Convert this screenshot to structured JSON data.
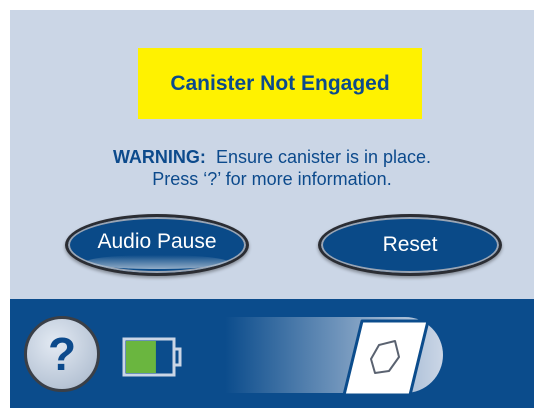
{
  "alert": {
    "title": "Canister Not Engaged"
  },
  "warning": {
    "label": "WARNING:",
    "line1": "Ensure canister is in place.",
    "line2": "Press ‘?’ for more information."
  },
  "buttons": {
    "audio_pause": "Audio Pause",
    "reset": "Reset"
  },
  "status_bar": {
    "help_label": "?",
    "battery_level": 0.65,
    "slider_position": "right"
  },
  "colors": {
    "screen_bg": "#cbd6e6",
    "alert_bg": "#fff200",
    "text_blue": "#0c4a8c",
    "bar_blue": "#0b4c8c",
    "button_blue": "#0a4a88",
    "battery_green": "#6ab63f"
  },
  "icons": {
    "help": "question-mark-icon",
    "battery": "battery-icon",
    "slider_knob": "slider-knob-icon"
  }
}
